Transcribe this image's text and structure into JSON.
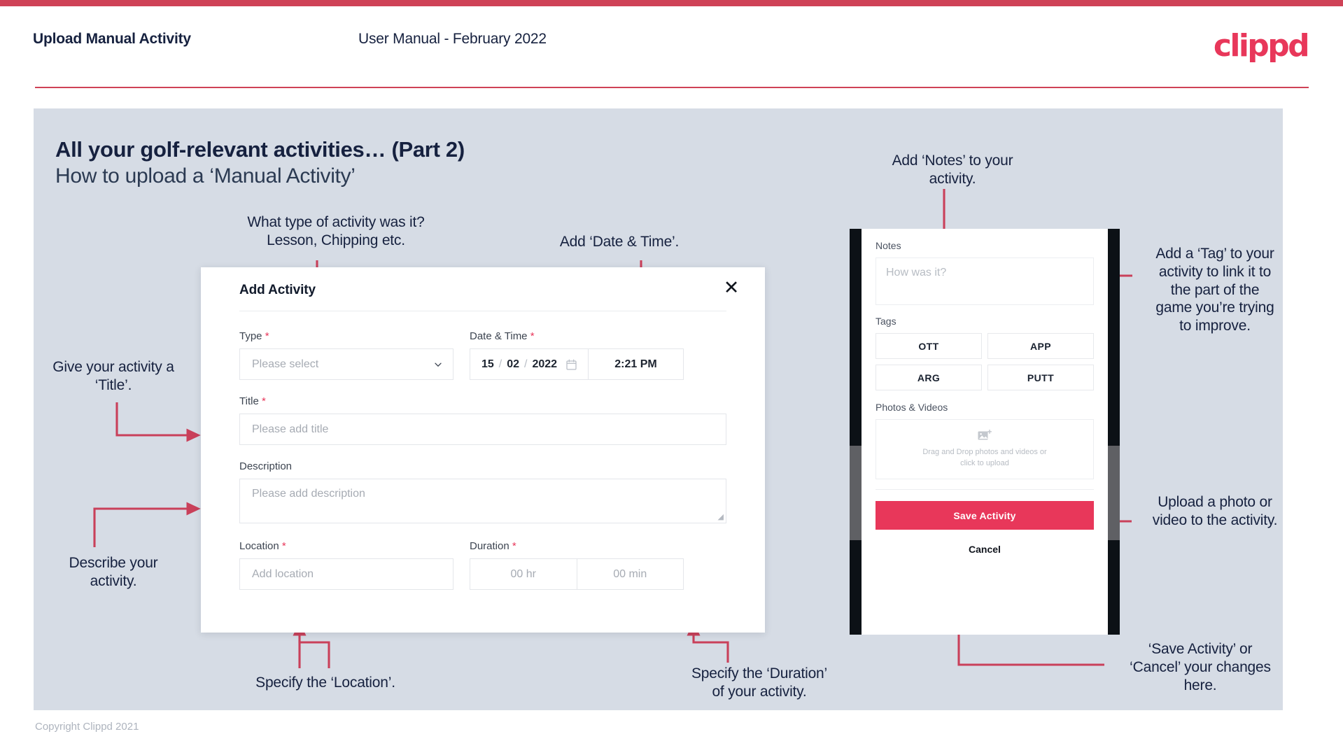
{
  "header": {
    "title": "Upload Manual Activity",
    "subtitle": "User Manual - February 2022",
    "logo": "clippd"
  },
  "slide": {
    "title": "All your golf-relevant activities… (Part 2)",
    "subtitle": "How to upload a ‘Manual Activity’",
    "copyright": "Copyright Clippd 2021"
  },
  "colors": {
    "accent": "#e8375a",
    "bar": "#cf4257",
    "panel": "#d6dce5",
    "ink": "#16213f"
  },
  "dialog": {
    "heading": "Add Activity",
    "close_icon": "close-icon",
    "fields": {
      "type": {
        "label": "Type",
        "required": "*",
        "placeholder": "Please select"
      },
      "datetime": {
        "label": "Date & Time",
        "required": "*",
        "day": "15",
        "month": "02",
        "year": "2022",
        "separator": "/",
        "time": "2:21 PM"
      },
      "title": {
        "label": "Title",
        "required": "*",
        "placeholder": "Please add title"
      },
      "description": {
        "label": "Description",
        "required": "",
        "placeholder": "Please add description"
      },
      "location": {
        "label": "Location",
        "required": "*",
        "placeholder": "Add location"
      },
      "duration": {
        "label": "Duration",
        "required": "*",
        "hours": "00 hr",
        "minutes": "00 min"
      }
    }
  },
  "phone": {
    "notes": {
      "label": "Notes",
      "placeholder": "How was it?"
    },
    "tags": {
      "label": "Tags",
      "items": [
        "OTT",
        "APP",
        "ARG",
        "PUTT"
      ]
    },
    "photos": {
      "label": "Photos & Videos",
      "dropzone_line1": "Drag and Drop photos and videos or",
      "dropzone_line2": "click to upload",
      "icon": "add-image-icon"
    },
    "save_label": "Save Activity",
    "cancel_label": "Cancel"
  },
  "annotations": {
    "type": "What type of activity was it?\nLesson, Chipping etc.",
    "datetime": "Add ‘Date & Time’.",
    "title": "Give your activity a\n‘Title’.",
    "description": "Describe your\nactivity.",
    "location": "Specify the ‘Location’.",
    "duration": "Specify the ‘Duration’\nof your activity.",
    "notes": "Add ‘Notes’ to your\nactivity.",
    "tags": "Add a ‘Tag’ to your\nactivity to link it to\nthe part of the\ngame you’re trying\nto improve.",
    "upload": "Upload a photo or\nvideo to the activity.",
    "save": "‘Save Activity’ or\n‘Cancel’ your changes\nhere."
  }
}
